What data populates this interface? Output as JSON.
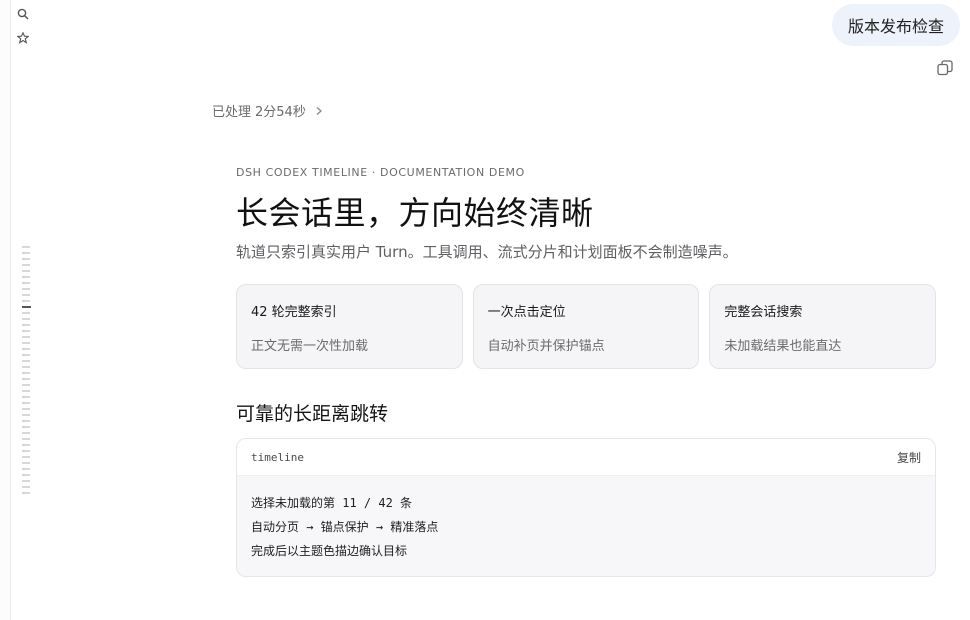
{
  "user_message": "版本发布检查",
  "processed": {
    "label": "已处理",
    "duration": "2分54秒"
  },
  "hero": {
    "eyebrow": "DSH CODEX TIMELINE · DOCUMENTATION DEMO",
    "title": "长会话里，方向始终清晰",
    "subtitle": "轨道只索引真实用户 Turn。工具调用、流式分片和计划面板不会制造噪声。"
  },
  "cards": [
    {
      "title": "42 轮完整索引",
      "desc": "正文无需一次性加载"
    },
    {
      "title": "一次点击定位",
      "desc": "自动补页并保护锚点"
    },
    {
      "title": "完整会话搜索",
      "desc": "未加载结果也能直达"
    }
  ],
  "section": {
    "title": "可靠的长距离跳转"
  },
  "code": {
    "language": "timeline",
    "copy_label": "复制",
    "lines": [
      "选择未加载的第 11 / 42 条",
      "自动分页 → 锚点保护 → 精准落点",
      "完成后以主题色描边确认目标"
    ]
  },
  "icons": {
    "search": "search-icon",
    "star": "star-icon",
    "copy": "copy-icon",
    "chevron": "chevron-right-icon"
  },
  "timeline_rail": {
    "total_markers": 42,
    "active_index": 11
  },
  "colors": {
    "bubble_bg": "#eef2fb",
    "card_bg": "#f5f5f7",
    "active_tick": "#55555c"
  }
}
